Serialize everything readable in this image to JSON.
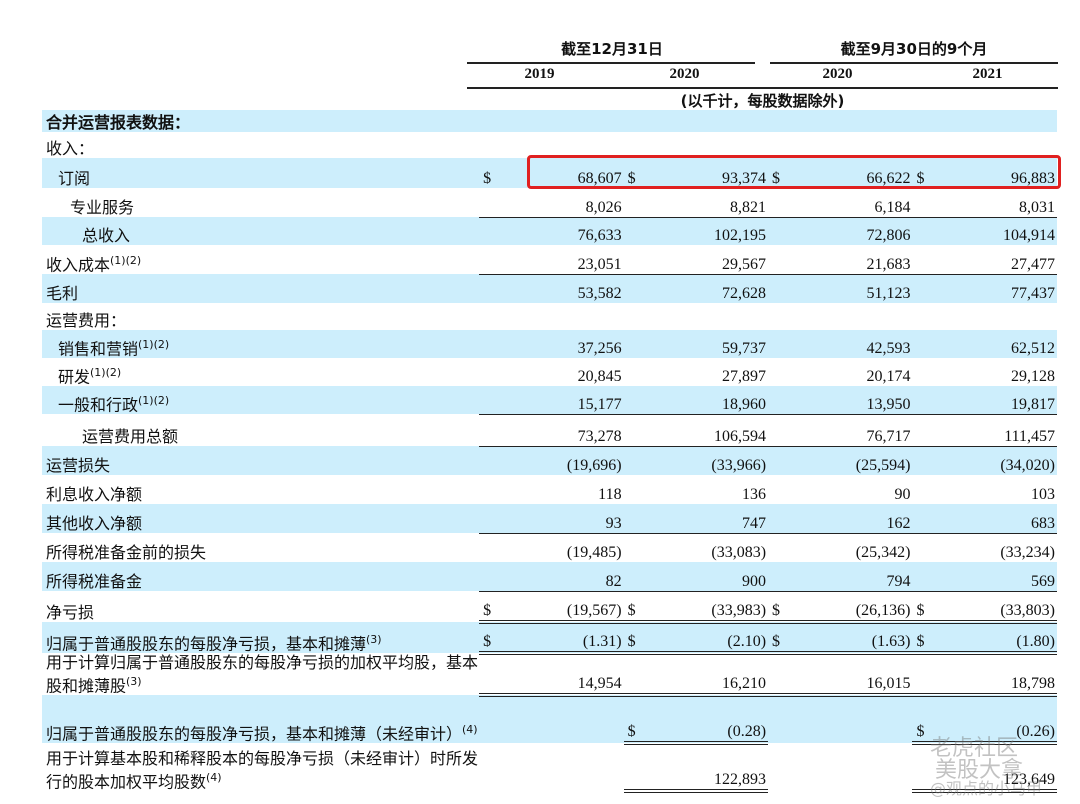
{
  "header": {
    "group1": "截至12月31日",
    "group2": "截至9月30日的9个月",
    "years": [
      "2019",
      "2020",
      "2020",
      "2021"
    ],
    "unit_note": "(以千计，每股数据除外)"
  },
  "rows": [
    {
      "label": "合并运营报表数据：",
      "bold": true,
      "shaded": true,
      "values": [
        "",
        "",
        "",
        ""
      ]
    },
    {
      "label": "收入：",
      "values": [
        "",
        "",
        "",
        ""
      ]
    },
    {
      "label": "订阅",
      "indent": 1,
      "shaded": true,
      "dollar": true,
      "values": [
        "68,607",
        "93,374",
        "66,622",
        "96,883"
      ]
    },
    {
      "label": "专业服务",
      "indent": 2,
      "u": 1,
      "values": [
        "8,026",
        "8,821",
        "6,184",
        "8,031"
      ]
    },
    {
      "label": "总收入",
      "indent": 3,
      "shaded": true,
      "values": [
        "76,633",
        "102,195",
        "72,806",
        "104,914"
      ]
    },
    {
      "label": "收入成本",
      "sup": "(1)(2)",
      "u": 1,
      "values": [
        "23,051",
        "29,567",
        "21,683",
        "27,477"
      ]
    },
    {
      "label": "毛利",
      "shaded": true,
      "values": [
        "53,582",
        "72,628",
        "51,123",
        "77,437"
      ]
    },
    {
      "label": "运营费用：",
      "values": [
        "",
        "",
        "",
        ""
      ]
    },
    {
      "label": "销售和营销",
      "sup": "(1)(2)",
      "indent": 1,
      "shaded": true,
      "values": [
        "37,256",
        "59,737",
        "42,593",
        "62,512"
      ]
    },
    {
      "label": "研发",
      "sup": "(1)(2)",
      "indent": 1,
      "values": [
        "20,845",
        "27,897",
        "20,174",
        "29,128"
      ]
    },
    {
      "label": "一般和行政",
      "sup": "(1)(2)",
      "indent": 1,
      "shaded": true,
      "u": 1,
      "values": [
        "15,177",
        "18,960",
        "13,950",
        "19,817"
      ]
    },
    {
      "label": "运营费用总额",
      "indent": 3,
      "u": 1,
      "values": [
        "73,278",
        "106,594",
        "76,717",
        "111,457"
      ]
    },
    {
      "label": "运营损失",
      "shaded": true,
      "values": [
        "(19,696)",
        "(33,966)",
        "(25,594)",
        "(34,020)"
      ]
    },
    {
      "label": "利息收入净额",
      "values": [
        "118",
        "136",
        "90",
        "103"
      ]
    },
    {
      "label": "其他收入净额",
      "shaded": true,
      "u": 1,
      "values": [
        "93",
        "747",
        "162",
        "683"
      ]
    },
    {
      "label": "所得税准备金前的损失",
      "values": [
        "(19,485)",
        "(33,083)",
        "(25,342)",
        "(33,234)"
      ]
    },
    {
      "label": "所得税准备金",
      "shaded": true,
      "u": 1,
      "values": [
        "82",
        "900",
        "794",
        "569"
      ]
    },
    {
      "label": "净亏损",
      "dollar": true,
      "u": 2,
      "values": [
        "(19,567)",
        "(33,983)",
        "(26,136)",
        "(33,803)"
      ]
    },
    {
      "label": "归属于普通股股东的每股净亏损，基本和摊薄",
      "sup": "(3)",
      "shaded": true,
      "dollar": true,
      "u": 2,
      "values": [
        "(1.31)",
        "(2.10)",
        "(1.63)",
        "(1.80)"
      ]
    },
    {
      "label": "用于计算归属于普通股股东的每股净亏损的加权平均股，基本股和摊薄股",
      "sup": "(3)",
      "u": 2,
      "values": [
        "14,954",
        "16,210",
        "16,015",
        "18,798"
      ]
    },
    {
      "label": "归属于普通股股东的每股净亏损，基本和摊薄（未经审计）",
      "sup": "(4)",
      "shaded": true,
      "dollarcols": [
        1,
        3
      ],
      "u": 2,
      "values": [
        "",
        "(0.28)",
        "",
        "(0.26)"
      ]
    },
    {
      "label": "用于计算基本股和稀释股本的每股净亏损（未经审计）时所发行的股本加权平均股数",
      "sup": "(4)",
      "u": 2,
      "values": [
        "",
        "122,893",
        "",
        "123,649"
      ]
    }
  ],
  "currency": "$",
  "watermark": [
    "老虎社区",
    "美股大拿",
    "@观点的小马甲"
  ],
  "highlight_color": "#e02020",
  "shade_color": "#cdeefc"
}
